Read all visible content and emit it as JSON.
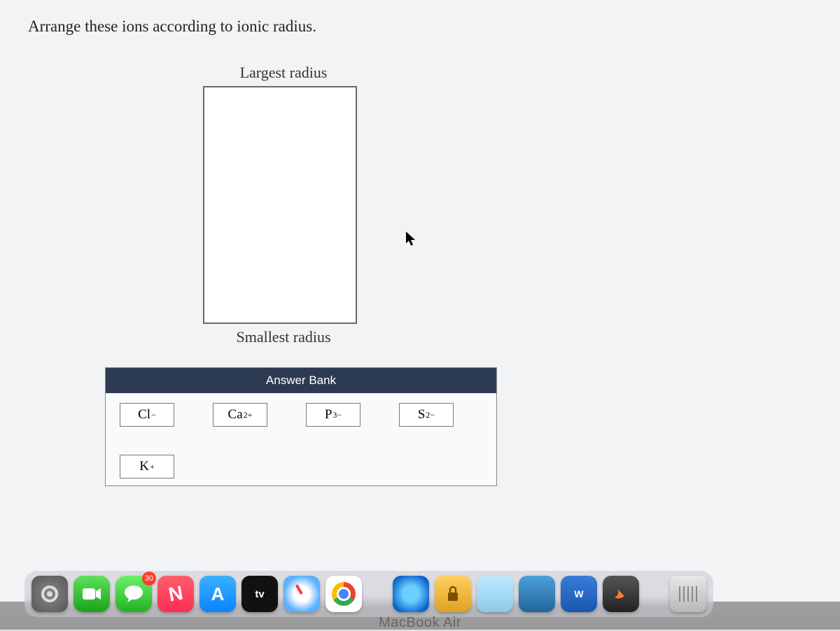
{
  "question": "Arrange these ions according to ionic radius.",
  "labels": {
    "top": "Largest radius",
    "bottom": "Smallest radius"
  },
  "answer_bank": {
    "title": "Answer Bank",
    "ions": [
      {
        "sym": "Cl",
        "charge": "−"
      },
      {
        "sym": "Ca",
        "charge": "2+"
      },
      {
        "sym": "P",
        "charge": "3−"
      },
      {
        "sym": "S",
        "charge": "2−"
      },
      {
        "sym": "K",
        "charge": "+"
      }
    ]
  },
  "dock": {
    "messages_badge": "30",
    "tv_text": "tv",
    "word_text": "W"
  },
  "device_label": "MacBook Air"
}
